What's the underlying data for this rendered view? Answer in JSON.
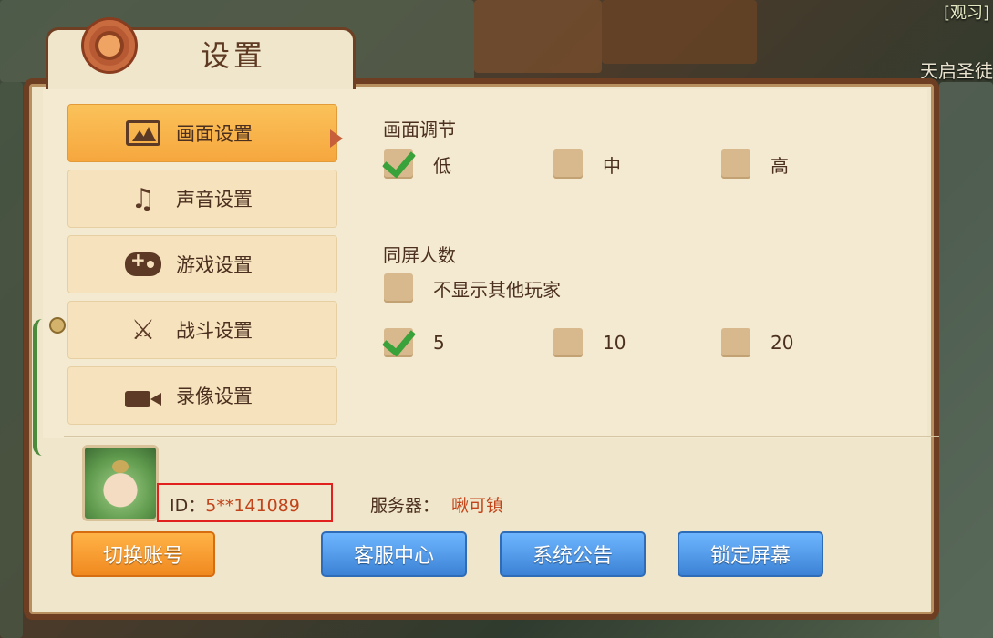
{
  "background": {
    "top_right_text": "[观习]",
    "right_text": "天启圣徒"
  },
  "window": {
    "title": "设置"
  },
  "sidebar": {
    "items": [
      {
        "label": "画面设置",
        "icon": "picture-icon",
        "active": true
      },
      {
        "label": "声音设置",
        "icon": "music-note-icon",
        "active": false
      },
      {
        "label": "游戏设置",
        "icon": "gamepad-icon",
        "active": false
      },
      {
        "label": "战斗设置",
        "icon": "crossed-swords-icon",
        "active": false
      },
      {
        "label": "录像设置",
        "icon": "video-camera-icon",
        "active": false
      }
    ]
  },
  "graphics": {
    "quality": {
      "title": "画面调节",
      "options": [
        {
          "label": "低",
          "checked": true
        },
        {
          "label": "中",
          "checked": false
        },
        {
          "label": "高",
          "checked": false
        }
      ]
    },
    "players_on_screen": {
      "title": "同屏人数",
      "hide_others": {
        "label": "不显示其他玩家",
        "checked": false
      },
      "options": [
        {
          "label": "5",
          "checked": true
        },
        {
          "label": "10",
          "checked": false
        },
        {
          "label": "20",
          "checked": false
        }
      ]
    }
  },
  "player": {
    "name": "",
    "id_label": "ID：",
    "id_value": "5**141089",
    "server_label": "服务器：",
    "server_value": "啾可镇"
  },
  "buttons": {
    "switch_account": "切换账号",
    "customer_service": "客服中心",
    "announcements": "系统公告",
    "lock_screen": "锁定屏幕"
  },
  "colors": {
    "accent_orange": "#f6a73e",
    "button_blue": "#3b82d6",
    "checkmark_green": "#3aa23a",
    "highlight_red": "#e0211e"
  }
}
